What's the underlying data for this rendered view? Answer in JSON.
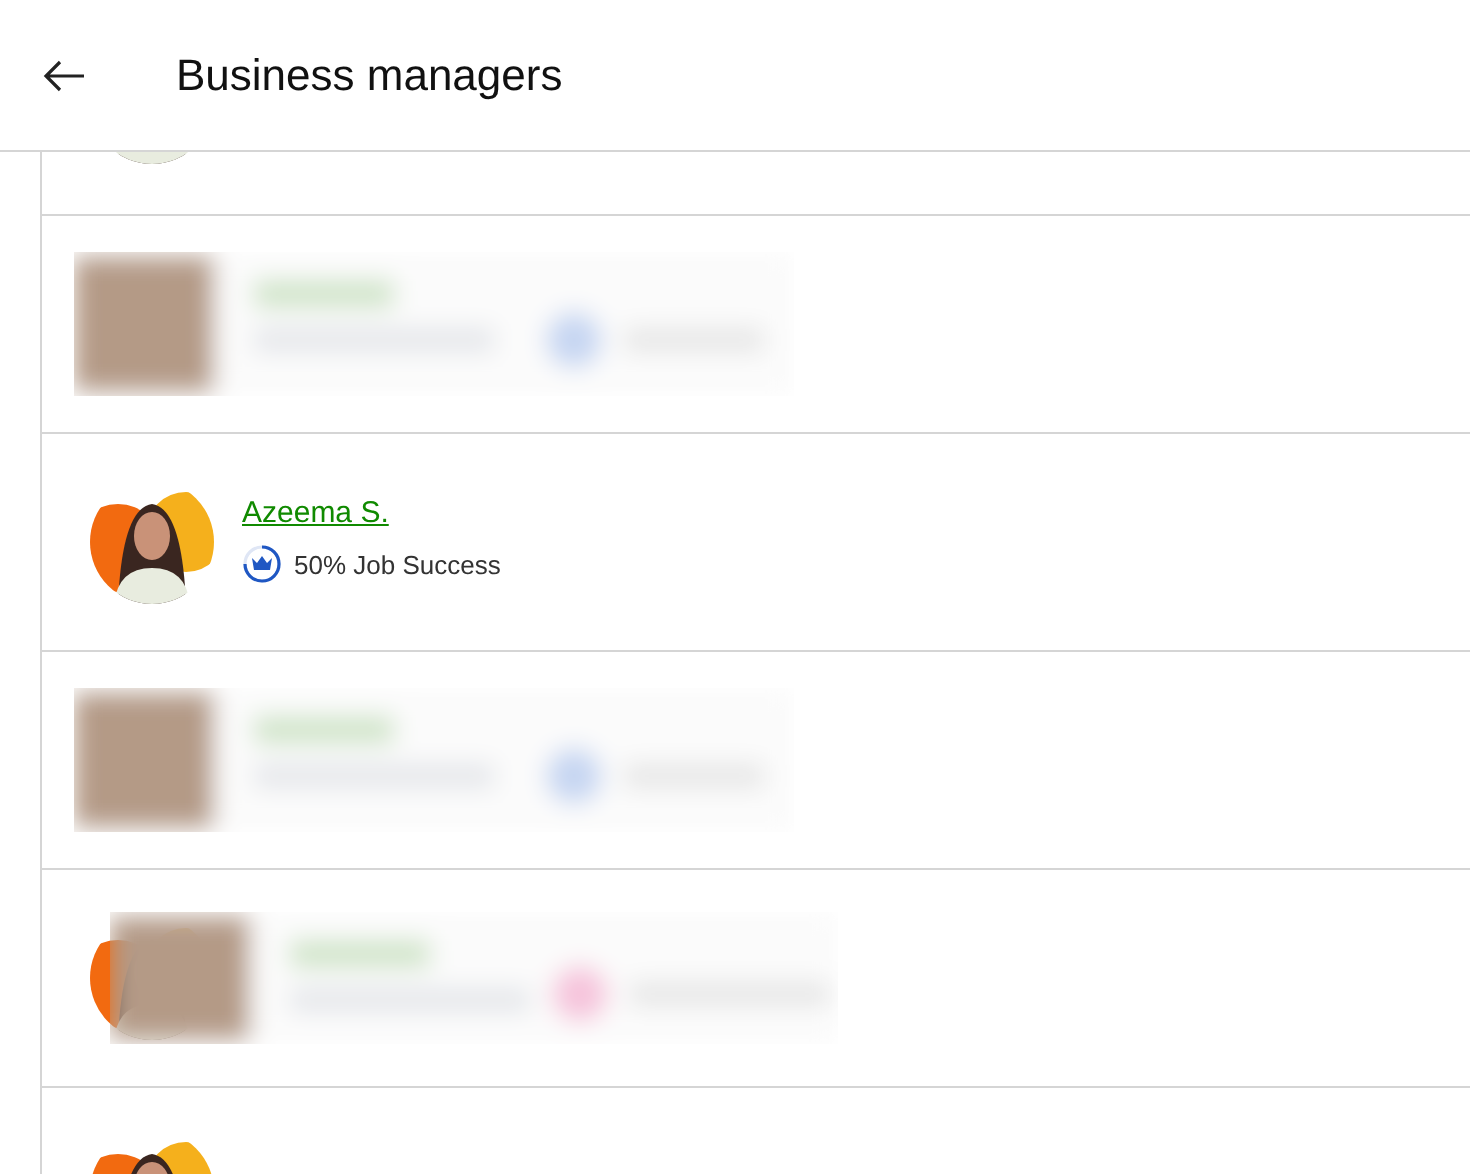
{
  "header": {
    "title": "Business managers"
  },
  "rows": [
    {
      "kind": "partial"
    },
    {
      "kind": "blurred"
    },
    {
      "kind": "profile",
      "name": "Azeema S.",
      "badge": "50% Job Success"
    },
    {
      "kind": "blurred"
    },
    {
      "kind": "blurred_avatar"
    },
    {
      "kind": "partial_top"
    }
  ]
}
